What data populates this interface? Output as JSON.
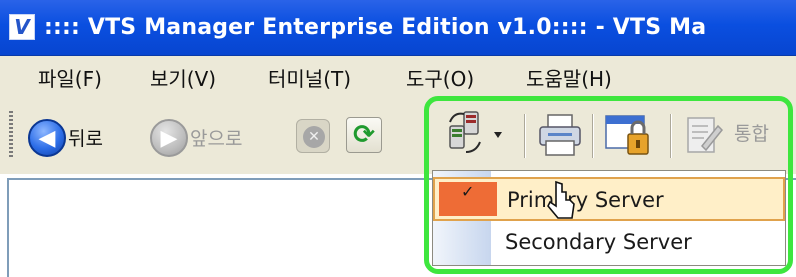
{
  "window": {
    "title": ":::: VTS Manager Enterprise Edition v1.0:::: - VTS Ma",
    "app_icon_letter": "V",
    "title_bar_color": "#0a4fe0"
  },
  "menu": {
    "items": [
      {
        "label": "파일(F)"
      },
      {
        "label": "보기(V)"
      },
      {
        "label": "터미널(T)"
      },
      {
        "label": "도구(O)"
      },
      {
        "label": "도움말(H)"
      }
    ]
  },
  "toolbar": {
    "back_label": "뒤로",
    "forward_label": "앞으로",
    "integrate_label": "통합",
    "buttons": [
      {
        "icon": "back-arrow-icon",
        "enabled": true
      },
      {
        "icon": "forward-arrow-icon",
        "enabled": false
      },
      {
        "icon": "stop-icon",
        "enabled": false
      },
      {
        "icon": "refresh-icon",
        "enabled": true
      },
      {
        "icon": "server-switch-icon",
        "enabled": true
      },
      {
        "icon": "printer-icon",
        "enabled": true
      },
      {
        "icon": "lock-window-icon",
        "enabled": true
      },
      {
        "icon": "edit-document-icon",
        "enabled": false
      }
    ]
  },
  "server_menu": {
    "items": [
      {
        "label": "Primary Server",
        "checked": true,
        "highlighted": true
      },
      {
        "label": "Secondary Server",
        "checked": false,
        "highlighted": false
      }
    ],
    "check_mark": "✓"
  },
  "colors": {
    "highlight_frame": "#3ee63e",
    "menu_hover": "#ffefc8",
    "check_background": "#ee6c36",
    "chrome": "#ece9d8"
  }
}
